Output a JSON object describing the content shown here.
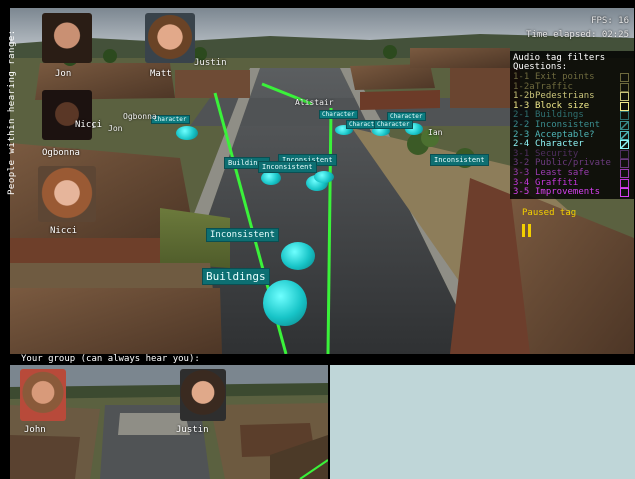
{
  "hud": {
    "fps": "FPS: 16",
    "time_elapsed": "Time elapsed: 02:25",
    "hearing_range_label": "People within hearing range:"
  },
  "people_in_range": [
    {
      "name": "Jon"
    },
    {
      "name": "Matt"
    },
    {
      "name": "Nicci"
    },
    {
      "name": "Ogbonna"
    },
    {
      "name": "Nicci"
    }
  ],
  "scene_names": [
    "Justin",
    "Alistair",
    "Jon",
    "Ogbonna",
    "Ian",
    "Nicci"
  ],
  "scene_tags": {
    "inconsistent_big": "Inconsistent",
    "buildings_big": "Buildings",
    "buildings_small": "Buildings",
    "inconsistent_mid": "Inconsistent",
    "inconsistent_mid2": "Inconsistent",
    "inconsistent_right": "Inconsistent",
    "character_1": "Character",
    "character_2": "Character",
    "character_3": "Character",
    "character_4": "Character",
    "character_5": "Character"
  },
  "filters": {
    "title": "Audio tag filters",
    "subtitle": "Questions:",
    "items": [
      {
        "code": "1-1",
        "label": "Exit points",
        "color": "#6e6a3e",
        "checked": false
      },
      {
        "code": "1-2a",
        "label": "Traffic",
        "color": "#6e6a3e",
        "checked": false
      },
      {
        "code": "1-2b",
        "label": "Pedestrians",
        "color": "#c9c47a",
        "checked": false
      },
      {
        "code": "1-3",
        "label": "Block size",
        "color": "#f0e98a",
        "checked": false
      },
      {
        "code": "2-1",
        "label": "Buildings",
        "color": "#2e6f70",
        "checked": false
      },
      {
        "code": "2-2",
        "label": "Inconsistent",
        "color": "#3a8d8f",
        "checked": true
      },
      {
        "code": "2-3",
        "label": "Acceptable?",
        "color": "#4fb6b8",
        "checked": true
      },
      {
        "code": "2-4",
        "label": "Character",
        "color": "#8ef4f6",
        "checked": true
      },
      {
        "code": "3-1",
        "label": "Security",
        "color": "#4e2e5e",
        "checked": false
      },
      {
        "code": "3-2",
        "label": "Public/private",
        "color": "#6b3a7e",
        "checked": false
      },
      {
        "code": "3-3",
        "label": "Least safe",
        "color": "#9a3cb0",
        "checked": false
      },
      {
        "code": "3-4",
        "label": "Graffiti",
        "color": "#c437dc",
        "checked": false
      },
      {
        "code": "3-5",
        "label": "Improvements",
        "color": "#d640f0",
        "checked": false
      }
    ]
  },
  "paused": {
    "label": "Paused tag"
  },
  "group": {
    "label": "Your group (can always hear you):",
    "members": [
      {
        "name": "John"
      },
      {
        "name": "Justin"
      }
    ]
  },
  "colors": {
    "route_line": "#3af23a",
    "tag_bg": "#0d6f72",
    "blob": "#17c4c7",
    "paused": "#f3d000"
  }
}
